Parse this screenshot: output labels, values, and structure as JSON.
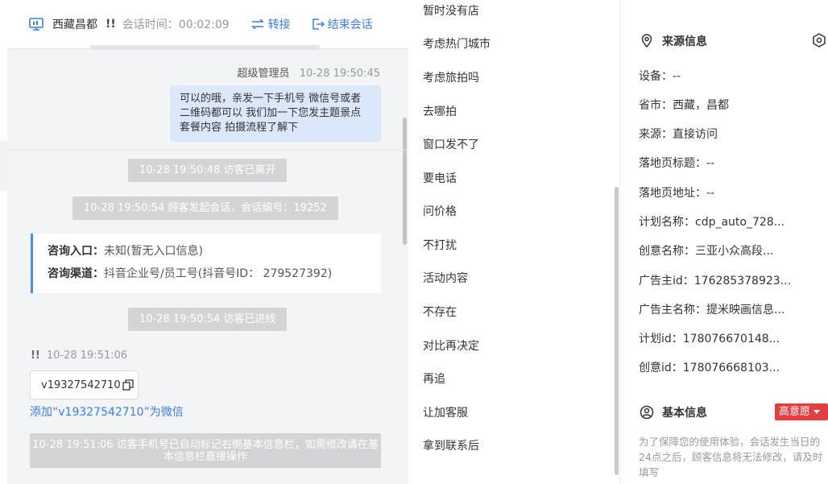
{
  "header": {
    "location": "西藏昌都",
    "flag": "!!",
    "session_time": "会话时间：00:02:09",
    "transfer_label": "转接",
    "end_label": "结束会话"
  },
  "chat": {
    "last_message": {
      "author": "超级管理员",
      "time": "10-28 19:50:45",
      "text": "可以的哦，亲发一下手机号 微信号或者二维码都可以 我们加一下您发主题景点 套餐内容 拍摄流程了解下"
    },
    "sys_left": "10-28 19:50:48 访客已离开",
    "sys_session": "10-28 19:50:54 顾客发起会话，会话编号：19252",
    "info_card": {
      "entry_label": "咨询入口：",
      "entry_value": "未知(暂无入口信息)",
      "channel_label": "咨询渠道：",
      "channel_value": "抖音企业号/员工号(抖音号ID： 279527392)"
    },
    "sys_joined": "10-28 19:50:54 访客已进线",
    "visitor_flag": "!!",
    "visitor_time": "10-28 19:51:06",
    "visitor_code": "v19327542710",
    "add_wechat": "添加“v19327542710”为微信",
    "notice": "10-28 19:51:06 访客手机号已自动标记右侧基本信息栏，如需修改请在基本信息栏直接操作"
  },
  "quick_replies": [
    "暂时没有店",
    "考虑热门城市",
    "考虑旅拍吗",
    "去哪拍",
    "窗口发不了",
    "要电话",
    "问价格",
    "不打扰",
    "活动内容",
    "不存在",
    "对比再决定",
    "再追",
    "让加客服",
    "拿到联系后"
  ],
  "side": {
    "source_title": "来源信息",
    "fields": [
      "设备：--",
      "省市：西藏，昌都",
      "来源：直接访问",
      "落地页标题：--",
      "落地页地址：--",
      "计划名称：cdp_auto_728...",
      "创意名称：三亚小众高段...",
      "广告主id：176285378923...",
      "广告主名称：提米映画信息...",
      "计划id：178076670148...",
      "创意id：178076668103..."
    ],
    "basic_title": "基本信息",
    "intent_label": "高意愿",
    "note": "为了保障您的使用体验，会话发生当日的24点之后，顾客信息将无法修改，请及时填写"
  },
  "colors": {
    "accent": "#3b7ee8",
    "bubble": "#dbe8fb",
    "system_pill": "#d3d4d6",
    "intent": "#e53e3e"
  }
}
